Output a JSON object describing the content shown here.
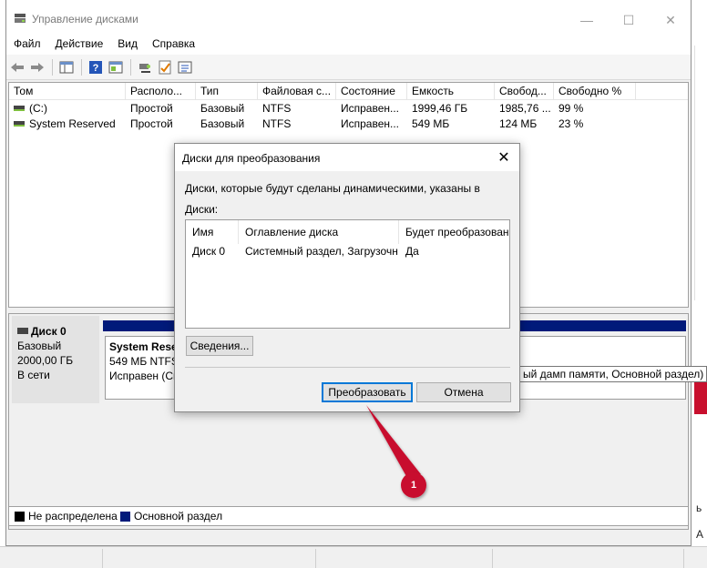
{
  "window": {
    "title": "Управление дисками",
    "controls": {
      "minimize": "—",
      "maximize": "☐",
      "close": "✕"
    }
  },
  "menu": [
    "Файл",
    "Действие",
    "Вид",
    "Справка"
  ],
  "toolbar_icons": [
    "back-icon",
    "forward-icon",
    "console-tree-icon",
    "help-icon",
    "details-icon",
    "connect-icon",
    "properties-icon",
    "list-icon"
  ],
  "volumes": {
    "columns": [
      "Том",
      "Располо...",
      "Тип",
      "Файловая с...",
      "Состояние",
      "Емкость",
      "Свобод...",
      "Свободно %"
    ],
    "rows": [
      [
        "(C:)",
        "Простой",
        "Базовый",
        "NTFS",
        "Исправен...",
        "1999,46 ГБ",
        "1985,76 ...",
        "99 %"
      ],
      [
        "System Reserved",
        "Простой",
        "Базовый",
        "NTFS",
        "Исправен...",
        "549 МБ",
        "124 МБ",
        "23 %"
      ]
    ]
  },
  "disk": {
    "name": "Диск 0",
    "type": "Базовый",
    "size": "2000,00 ГБ",
    "status": "В сети",
    "partition": {
      "name": "System Rese",
      "size_fs": "549 МБ NTFS",
      "status": "Исправен (Си"
    },
    "tooltip": "ый дамп памяти, Основной раздел)"
  },
  "legend": [
    {
      "label": "Не распределена",
      "color": "#000000"
    },
    {
      "label": "Основной раздел",
      "color": "#001a7a"
    }
  ],
  "dialog": {
    "title": "Диски для преобразования",
    "close": "✕",
    "description": "Диски, которые будут сделаны динамическими, указаны в",
    "list_label": "Диски:",
    "columns": [
      "Имя",
      "Оглавление диска",
      "Будет преобразован"
    ],
    "rows": [
      [
        "Диск 0",
        "Системный раздел, Загрузочн...",
        "Да"
      ]
    ],
    "details_button": "Сведения...",
    "convert_button": "Преобразовать",
    "cancel_button": "Отмена"
  },
  "annotation": {
    "number": "1",
    "color": "#c8102e"
  },
  "background_right_chars": [
    "ь",
    "А"
  ]
}
